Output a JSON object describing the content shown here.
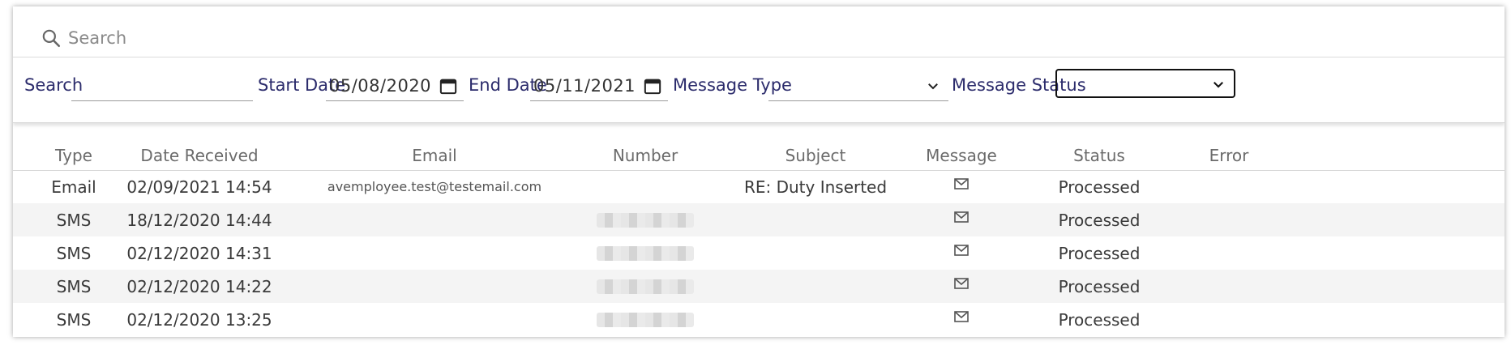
{
  "top_search": {
    "placeholder": "Search",
    "icon": "search-icon"
  },
  "filters": {
    "search_label": "Search",
    "search_value": "",
    "start_date_label": "Start Date",
    "start_date_value": "05/08/2020",
    "end_date_label": "End Date",
    "end_date_value": "05/11/2021",
    "message_type_label": "Message Type",
    "message_type_value": "",
    "message_status_label": "Message Status",
    "message_status_value": ""
  },
  "table": {
    "columns": [
      "Type",
      "Date Received",
      "Email",
      "Number",
      "Subject",
      "Message",
      "Status",
      "Error"
    ],
    "rows": [
      {
        "type": "Email",
        "date": "02/09/2021 14:54",
        "email": "avemployee.test@testemail.com",
        "number": "",
        "subject": "RE: Duty Inserted",
        "message_icon": "envelope-icon",
        "status": "Processed",
        "error": ""
      },
      {
        "type": "SMS",
        "date": "18/12/2020 14:44",
        "email": "",
        "number": "(redacted)",
        "subject": "",
        "message_icon": "envelope-icon",
        "status": "Processed",
        "error": ""
      },
      {
        "type": "SMS",
        "date": "02/12/2020 14:31",
        "email": "",
        "number": "(redacted)",
        "subject": "",
        "message_icon": "envelope-icon",
        "status": "Processed",
        "error": ""
      },
      {
        "type": "SMS",
        "date": "02/12/2020 14:22",
        "email": "",
        "number": "(redacted)",
        "subject": "",
        "message_icon": "envelope-icon",
        "status": "Processed",
        "error": ""
      },
      {
        "type": "SMS",
        "date": "02/12/2020 13:25",
        "email": "",
        "number": "(redacted)",
        "subject": "",
        "message_icon": "envelope-icon",
        "status": "Processed",
        "error": ""
      }
    ]
  },
  "colors": {
    "label": "#2c2c6c",
    "header_text": "#6b6b6b",
    "alt_row": "#f4f4f4"
  }
}
